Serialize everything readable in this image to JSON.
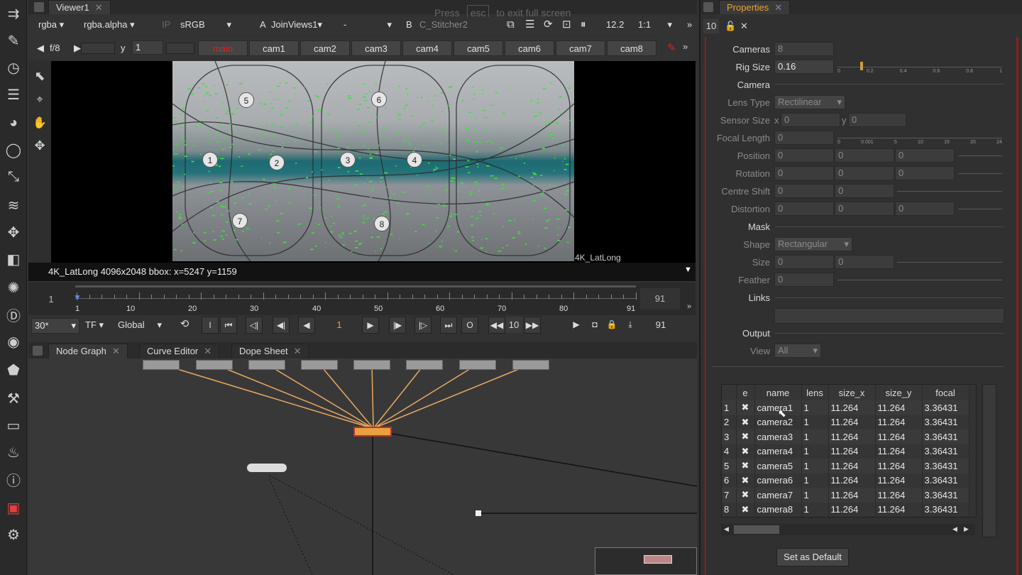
{
  "viewer": {
    "tab_title": "Viewer1",
    "channels": "rgba",
    "alpha": "rgba.alpha",
    "ip": "IP",
    "colorspace": "sRGB",
    "a_label": "A",
    "a_input": "JoinViews1",
    "a_dash": "-",
    "b_label": "B",
    "b_input": "C_Stitcher2",
    "gain": "12.2",
    "zoom": "1:1",
    "fstop": "f/8",
    "y_label": "y",
    "y_value": "1"
  },
  "views": [
    "main",
    "cam1",
    "cam2",
    "cam3",
    "cam4",
    "cam5",
    "cam6",
    "cam7",
    "cam8"
  ],
  "overlay_hint": {
    "press": "Press",
    "key": "esc",
    "rest": "to exit full screen"
  },
  "markers": [
    "1",
    "2",
    "3",
    "4",
    "5",
    "6",
    "7",
    "8"
  ],
  "format_label": "4K_LatLong",
  "info_bar": "4K_LatLong 4096x2048  bbox:  x=5247 y=1159",
  "timeline": {
    "start": "1",
    "end": "91",
    "ticks": [
      "1",
      "10",
      "20",
      "30",
      "40",
      "50",
      "60",
      "70",
      "80",
      "91"
    ]
  },
  "transport": {
    "fps": "30*",
    "tf": "TF",
    "range": "Global",
    "i": "I",
    "o": "O",
    "frame": "1",
    "step": "10",
    "end": "91"
  },
  "panel_tabs": [
    {
      "label": "Node Graph"
    },
    {
      "label": "Curve Editor"
    },
    {
      "label": "Dope Sheet"
    }
  ],
  "properties": {
    "tab_title": "Properties",
    "count": "10",
    "cameras_label": "Cameras",
    "cameras_value": "8",
    "rig_size_label": "Rig Size",
    "rig_size_value": "0.16",
    "camera_section": "Camera",
    "lens_type_label": "Lens Type",
    "lens_type_value": "Rectilinear",
    "sensor_size_label": "Sensor Size",
    "sensor_x_label": "x",
    "sensor_x": "0",
    "sensor_y_label": "y",
    "sensor_y": "0",
    "focal_length_label": "Focal Length",
    "focal_length": "0",
    "position_label": "Position",
    "rotation_label": "Rotation",
    "centre_shift_label": "Centre Shift",
    "distortion_label": "Distortion",
    "zero": "0",
    "mask_section": "Mask",
    "shape_label": "Shape",
    "shape_value": "Rectangular",
    "size_label": "Size",
    "feather_label": "Feather",
    "links_section": "Links",
    "output_section": "Output",
    "view_label": "View",
    "view_value": "All",
    "set_default": "Set as Default",
    "slider_ticks_a": [
      "0",
      "0.2",
      "0.4",
      "0.6",
      "0.8",
      "1"
    ],
    "slider_ticks_b": [
      "0",
      "0.001",
      "5",
      "10",
      "15",
      "20",
      "24"
    ]
  },
  "table": {
    "columns": [
      "e",
      "name",
      "lens",
      "size_x",
      "size_y",
      "focal"
    ],
    "rows": [
      {
        "idx": "1",
        "name": "camera1",
        "lens": "1",
        "sx": "11.264",
        "sy": "11.264",
        "focal": "3.36431"
      },
      {
        "idx": "2",
        "name": "camera2",
        "lens": "1",
        "sx": "11.264",
        "sy": "11.264",
        "focal": "3.36431"
      },
      {
        "idx": "3",
        "name": "camera3",
        "lens": "1",
        "sx": "11.264",
        "sy": "11.264",
        "focal": "3.36431"
      },
      {
        "idx": "4",
        "name": "camera4",
        "lens": "1",
        "sx": "11.264",
        "sy": "11.264",
        "focal": "3.36431"
      },
      {
        "idx": "5",
        "name": "camera5",
        "lens": "1",
        "sx": "11.264",
        "sy": "11.264",
        "focal": "3.36431"
      },
      {
        "idx": "6",
        "name": "camera6",
        "lens": "1",
        "sx": "11.264",
        "sy": "11.264",
        "focal": "3.36431"
      },
      {
        "idx": "7",
        "name": "camera7",
        "lens": "1",
        "sx": "11.264",
        "sy": "11.264",
        "focal": "3.36431"
      },
      {
        "idx": "8",
        "name": "camera8",
        "lens": "1",
        "sx": "11.264",
        "sy": "11.264",
        "focal": "3.36431"
      }
    ]
  }
}
